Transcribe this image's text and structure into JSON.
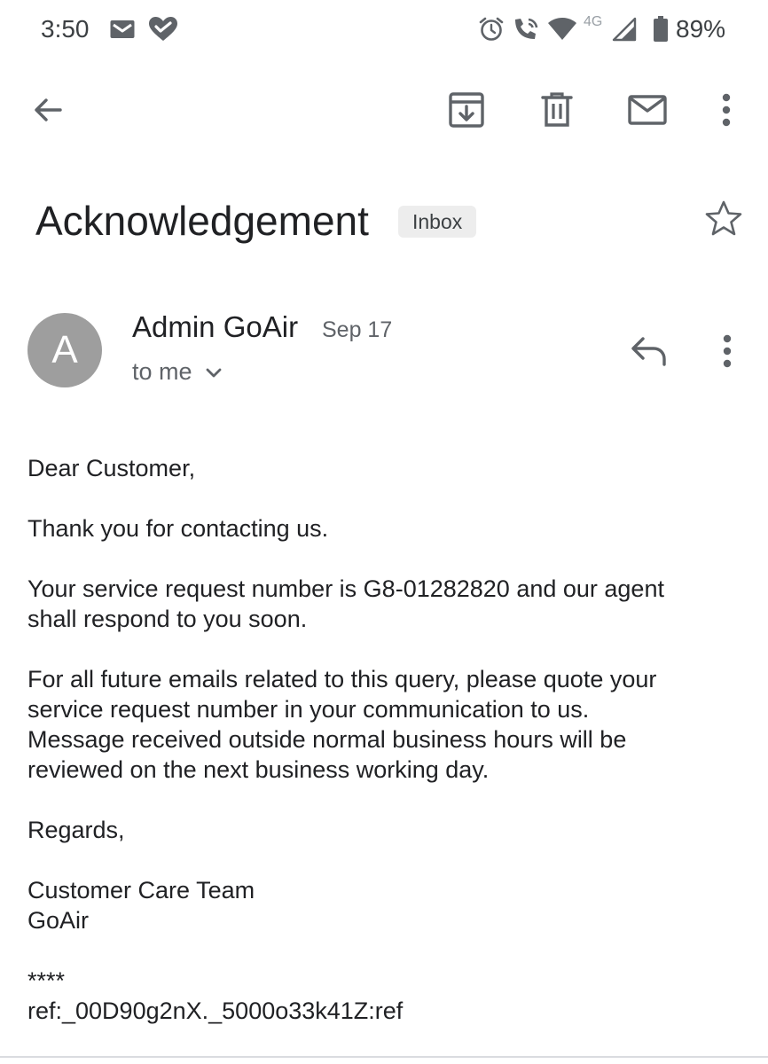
{
  "status_bar": {
    "time": "3:50",
    "network_type": "4G",
    "battery": "89%",
    "left_icons": [
      "gmail-icon",
      "health-heart-icon"
    ],
    "right_icons": [
      "alarm-icon",
      "wifi-calling-icon",
      "wifi-icon",
      "signal-icon",
      "battery-icon"
    ]
  },
  "toolbar": {
    "icons": [
      "back-arrow-icon",
      "archive-icon",
      "delete-icon",
      "mark-unread-icon",
      "more-vert-icon"
    ]
  },
  "email": {
    "subject": "Acknowledgement",
    "label": "Inbox",
    "sender": {
      "avatar_letter": "A",
      "name": "Admin GoAir",
      "date": "Sep 17",
      "recipient": "to me"
    },
    "body": {
      "greeting": "Dear Customer,",
      "thanks": "Thank you for contacting us.",
      "request_line1": "Your service request number is G8-01282820 and our agent",
      "request_line2": "shall respond to you soon.",
      "future_line1": "For all future emails related to this query, please quote your",
      "future_line2": "service request number in your communication to us.",
      "future_line3": "Message received outside normal business hours will be",
      "future_line4": "reviewed on the next business working day.",
      "regards": "Regards,",
      "team": "Customer Care Team",
      "company": "GoAir",
      "stars": "****",
      "ref": "ref:_00D90g2nX._5000o33k41Z:ref"
    }
  },
  "colors": {
    "icon_gray": "#5f6368",
    "avatar_bg": "#9e9e9e",
    "chip_bg": "#ededed"
  }
}
